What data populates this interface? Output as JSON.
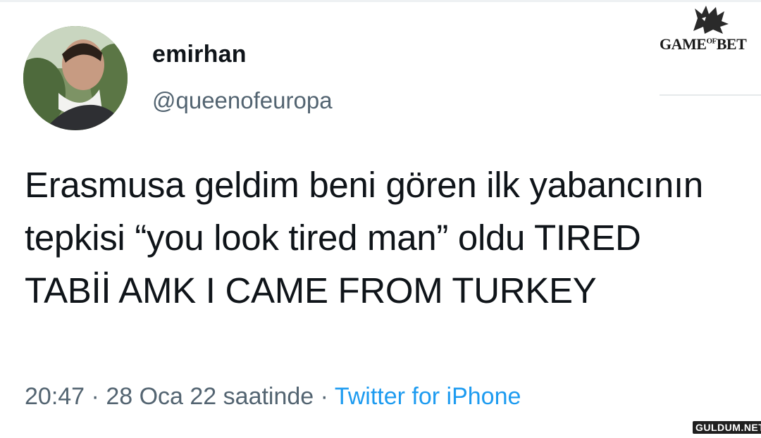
{
  "tweet": {
    "display_name": "emirhan",
    "handle": "@queenofeuropa",
    "text": "Erasmusa geldim beni gören ilk yabancının tepkisi “you look tired man” oldu TIRED TABİİ AMK I CAME FROM TURKEY",
    "time": "20:47",
    "separator": "·",
    "date": "28 Oca 22 saatinde",
    "source": "Twitter for iPhone"
  },
  "overlays": {
    "logo_text_main": "GAME",
    "logo_text_small": "OF",
    "logo_text_end": "BET",
    "watermark": "GULDUM.NET"
  },
  "colors": {
    "text_primary": "#0f1419",
    "text_secondary": "#536471",
    "link": "#1d9bf0"
  },
  "icons": {
    "logo": "wolf-emblem-icon"
  }
}
